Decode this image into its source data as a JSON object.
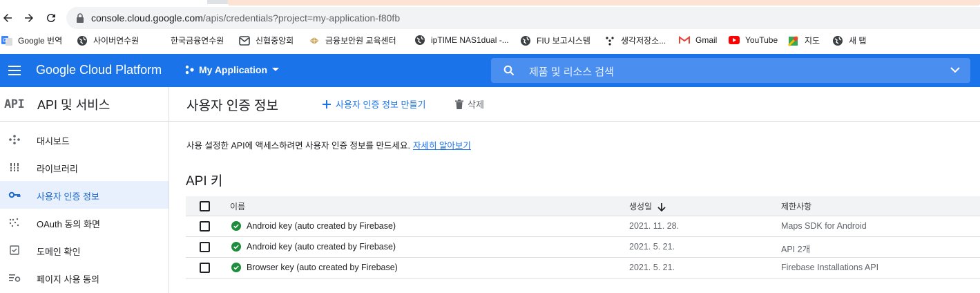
{
  "browser": {
    "url_domain": "console.cloud.google.com",
    "url_path": "/apis/credentials?project=my-application-f80fb"
  },
  "bookmarks": [
    {
      "label": "Google 번역",
      "icon": "google-translate-icon"
    },
    {
      "label": "사이버연수원",
      "icon": "globe-icon"
    },
    {
      "label": "한국금융연수원",
      "icon": "blank-icon"
    },
    {
      "label": "신협중앙회",
      "icon": "mail-icon"
    },
    {
      "label": "금융보안원 교육센터",
      "icon": "diamond-icon"
    },
    {
      "label": "ipTIME NAS1dual -...",
      "icon": "globe-icon"
    },
    {
      "label": "FIU 보고시스템",
      "icon": "globe-icon"
    },
    {
      "label": "생각저장소...",
      "icon": "dots-icon"
    },
    {
      "label": "Gmail",
      "icon": "gmail-icon"
    },
    {
      "label": "YouTube",
      "icon": "youtube-icon"
    },
    {
      "label": "지도",
      "icon": "maps-icon"
    },
    {
      "label": "새 탭",
      "icon": "globe-icon"
    }
  ],
  "header": {
    "brand": "Google Cloud Platform",
    "project": "My Application",
    "search_placeholder": "제품 및 리소스 검색"
  },
  "sidebar": {
    "badge": "API",
    "title": "API 및 서비스",
    "items": [
      {
        "label": "대시보드",
        "icon": "dashboard-icon",
        "active": false
      },
      {
        "label": "라이브러리",
        "icon": "library-icon",
        "active": false
      },
      {
        "label": "사용자 인증 정보",
        "icon": "key-icon",
        "active": true
      },
      {
        "label": "OAuth 동의 화면",
        "icon": "oauth-consent-icon",
        "active": false
      },
      {
        "label": "도메인 확인",
        "icon": "domain-check-icon",
        "active": false
      },
      {
        "label": "페이지 사용 동의",
        "icon": "page-consent-icon",
        "active": false
      }
    ]
  },
  "main": {
    "title": "사용자 인증 정보",
    "create_label": "사용자 인증 정보 만들기",
    "delete_label": "삭제",
    "description": "사용 설정한 API에 액세스하려면 사용자 인증 정보를 만드세요.",
    "learn_more": "자세히 알아보기",
    "section_title": "API 키",
    "table": {
      "columns": [
        "이름",
        "생성일",
        "제한사항"
      ],
      "rows": [
        {
          "name": "Android key (auto created by Firebase)",
          "created": "2021. 11. 28.",
          "restrictions": "Maps SDK for Android"
        },
        {
          "name": "Android key (auto created by Firebase)",
          "created": "2021. 5. 21.",
          "restrictions": "API 2개"
        },
        {
          "name": "Browser key (auto created by Firebase)",
          "created": "2021. 5. 21.",
          "restrictions": "Firebase Installations API"
        }
      ]
    }
  },
  "colors": {
    "brand_blue": "#1a73e8",
    "status_green": "#1e8e3e",
    "active_bg": "#e8f0fe"
  }
}
